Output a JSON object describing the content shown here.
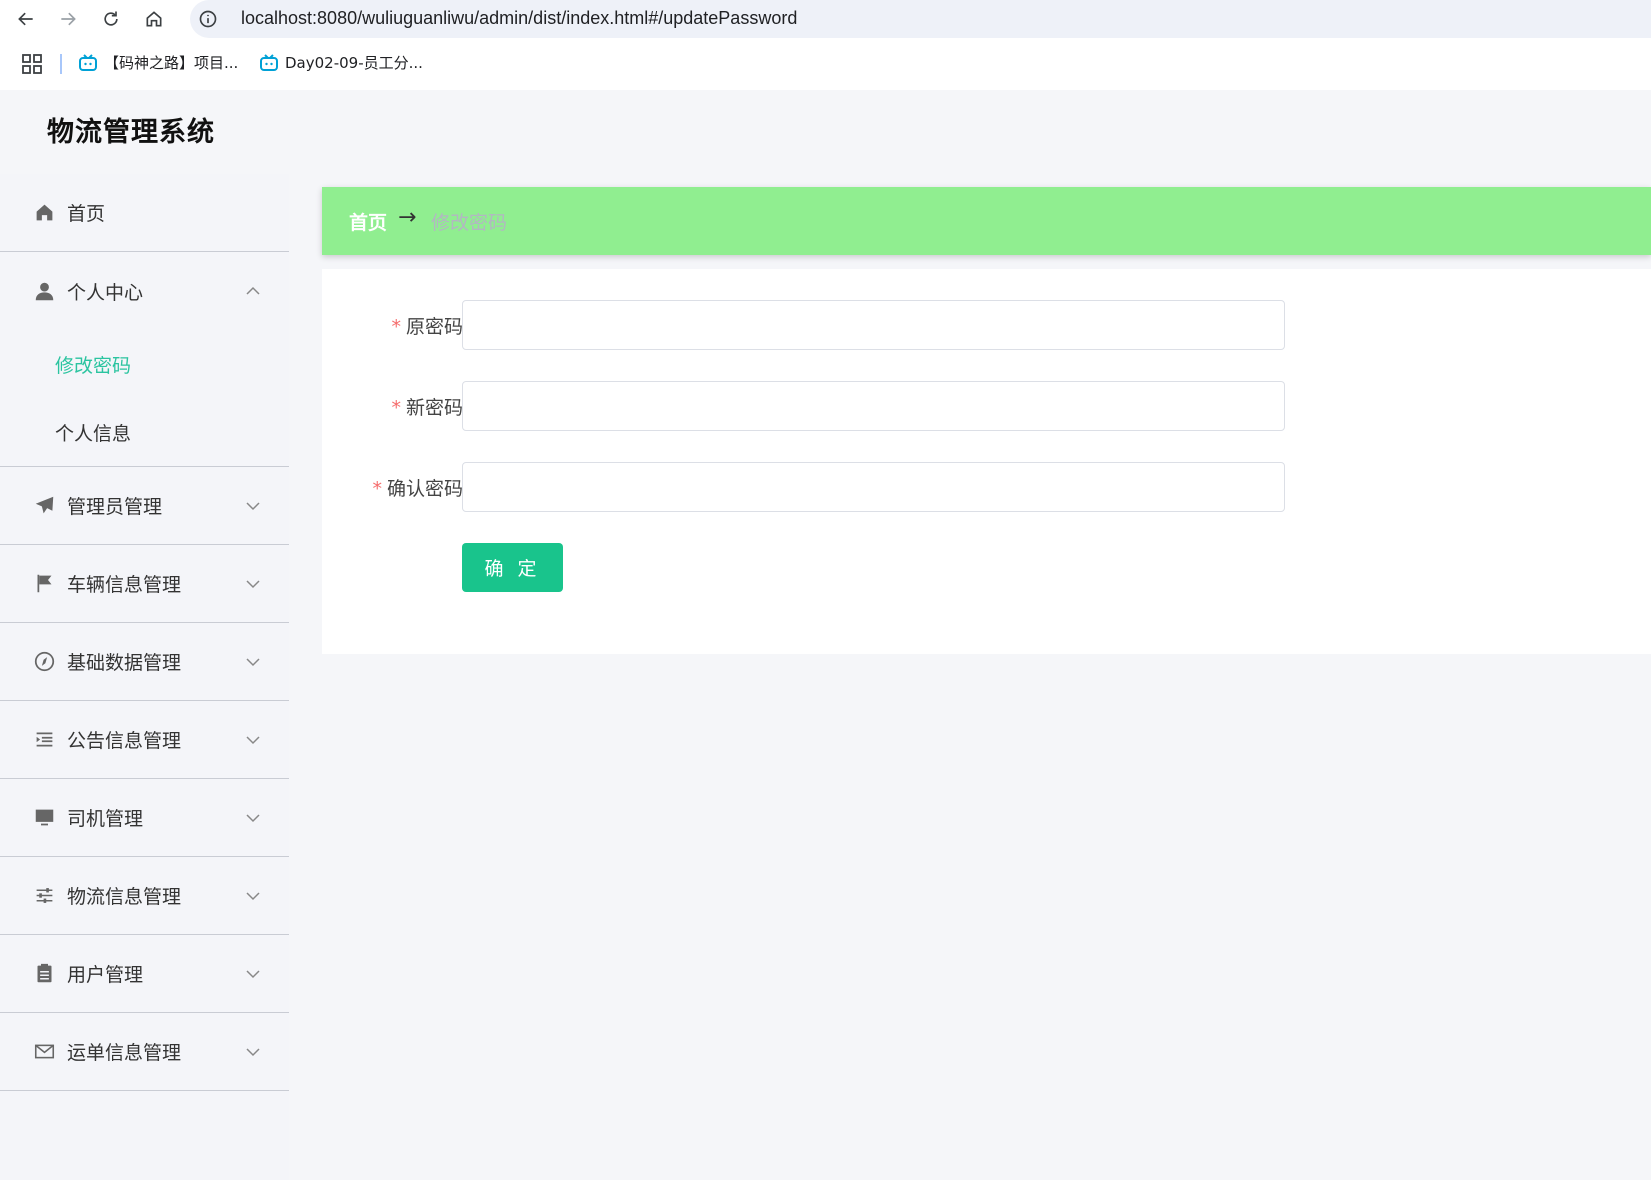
{
  "browser": {
    "url": "localhost:8080/wuliuguanliwu/admin/dist/index.html#/updatePassword",
    "bookmarks": [
      {
        "label": "【码神之路】项目..."
      },
      {
        "label": "Day02-09-员工分..."
      }
    ]
  },
  "app": {
    "title": "物流管理系统"
  },
  "sidebar": {
    "home": "首页",
    "personal_center": {
      "label": "个人中心",
      "children": [
        "修改密码",
        "个人信息"
      ]
    },
    "items": [
      {
        "label": "管理员管理",
        "icon": "paper-plane-icon"
      },
      {
        "label": "车辆信息管理",
        "icon": "flag-icon"
      },
      {
        "label": "基础数据管理",
        "icon": "compass-icon"
      },
      {
        "label": "公告信息管理",
        "icon": "list-indent-icon"
      },
      {
        "label": "司机管理",
        "icon": "monitor-icon"
      },
      {
        "label": "物流信息管理",
        "icon": "sliders-icon"
      },
      {
        "label": "用户管理",
        "icon": "clipboard-icon"
      },
      {
        "label": "运单信息管理",
        "icon": "mail-icon"
      }
    ]
  },
  "breadcrumb": {
    "home": "首页",
    "separator": "→",
    "current": "修改密码"
  },
  "form": {
    "required_mark": "*",
    "old_password_label": "原密码",
    "new_password_label": "新密码",
    "confirm_password_label": "确认密码",
    "submit_label": "确 定"
  },
  "colors": {
    "accent": "#2bc4a0",
    "breadcrumb_bg": "#90ee90",
    "button_bg": "#19c48c",
    "required": "#f56c6c"
  }
}
